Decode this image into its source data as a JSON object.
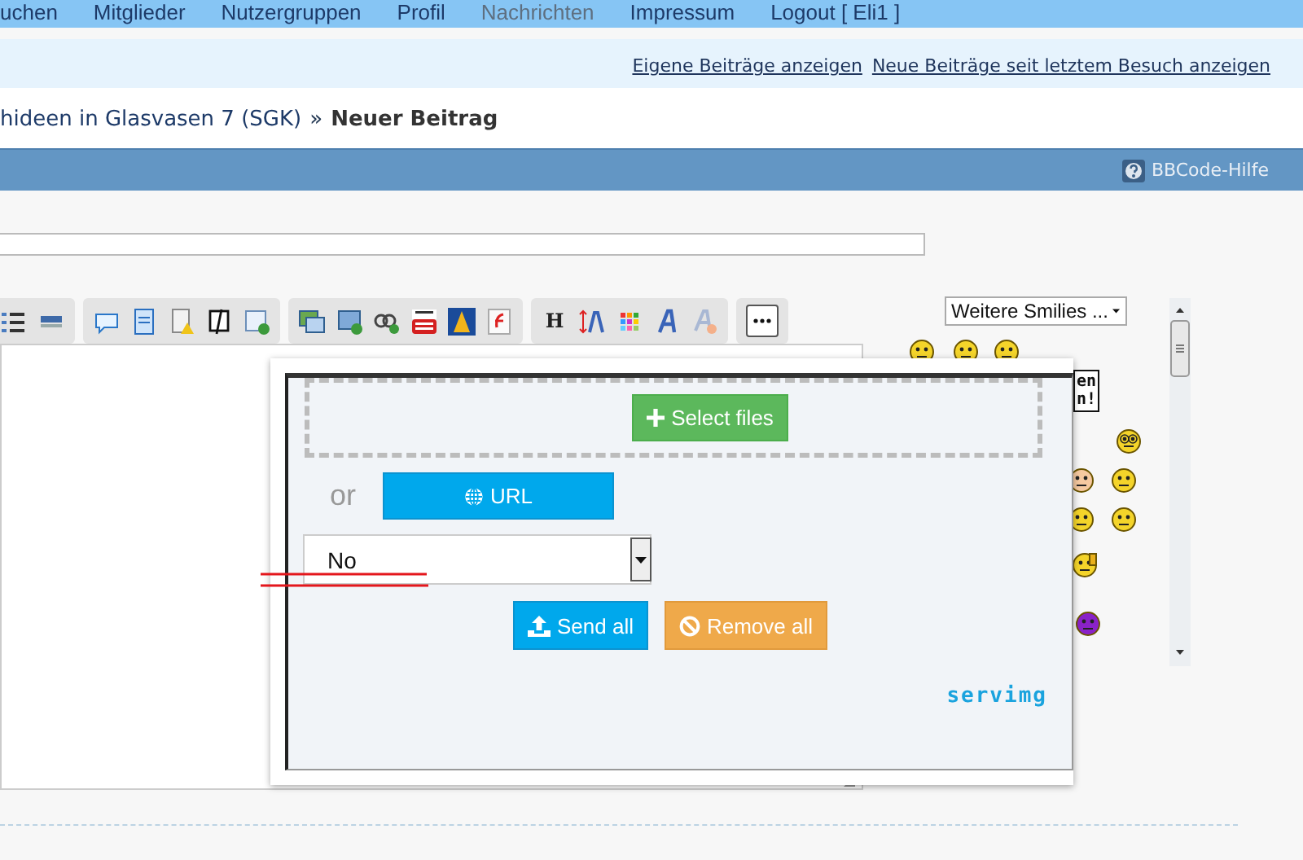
{
  "nav": {
    "items": [
      {
        "label": "uchen",
        "disabled": false
      },
      {
        "label": "Mitglieder",
        "disabled": false
      },
      {
        "label": "Nutzergruppen",
        "disabled": false
      },
      {
        "label": "Profil",
        "disabled": false
      },
      {
        "label": "Nachrichten",
        "disabled": true
      },
      {
        "label": "Impressum",
        "disabled": false
      },
      {
        "label": "Logout [ Eli1 ]",
        "disabled": false
      }
    ]
  },
  "quick_links": [
    "Eigene Beiträge anzeigen",
    "Neue Beiträge seit letztem Besuch anzeigen"
  ],
  "breadcrumb": {
    "parent": "hideen in Glasvasen 7 (SGK)",
    "separator": "»",
    "current": "Neuer Beitrag"
  },
  "header_bar": {
    "help_link": "BBCode-Hilfe"
  },
  "toolbar": {
    "heading_button": "H"
  },
  "smilies": {
    "dropdown": "Weitere Smilies ...",
    "sign_lines": [
      "en",
      "n!"
    ]
  },
  "upload_dialog": {
    "select_files": "Select files",
    "or_label": "or",
    "url_button": "URL",
    "resize_select": {
      "value": "No"
    },
    "send_all": "Send all",
    "remove_all": "Remove all",
    "logo": "servimg"
  }
}
